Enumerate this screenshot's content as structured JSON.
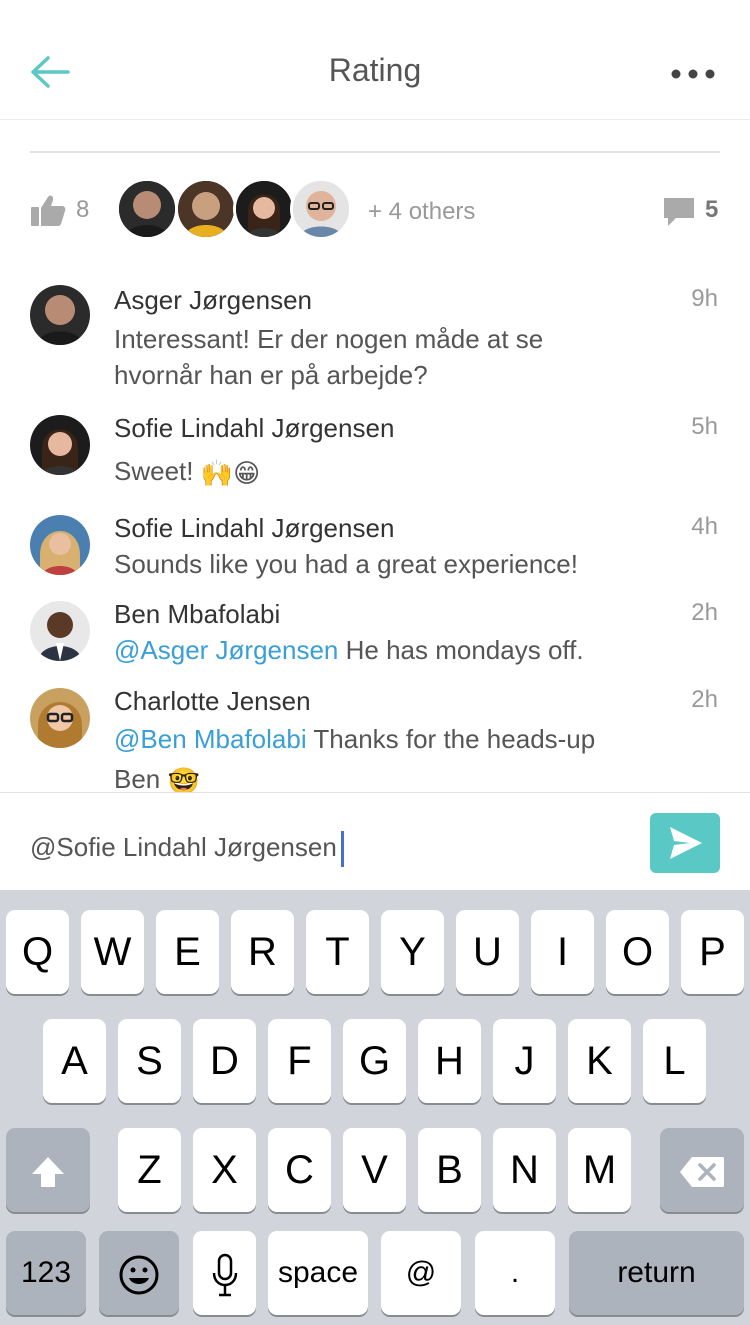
{
  "header": {
    "title": "Rating"
  },
  "likes": {
    "count": "8",
    "others": "+ 4 others",
    "comment_count": "5"
  },
  "comments": [
    {
      "name": "Asger Jørgensen",
      "time": "9h",
      "mention": "",
      "text": "Interessant! Er der nogen måde at se hvornår han er på arbejde?",
      "emoji": ""
    },
    {
      "name": "Sofie Lindahl Jørgensen",
      "time": "5h",
      "mention": "",
      "text": "Sweet!",
      "emoji": "🙌😁"
    },
    {
      "name": "Sofie Lindahl Jørgensen",
      "time": "4h",
      "mention": "",
      "text": "Sounds like you had a great experience!",
      "emoji": ""
    },
    {
      "name": "Ben Mbafolabi",
      "time": "2h",
      "mention": "@Asger Jørgensen",
      "text": "He has mondays off.",
      "emoji": ""
    },
    {
      "name": "Charlotte Jensen",
      "time": "2h",
      "mention": "@Ben Mbafolabi",
      "text": "Thanks for the heads-up Ben",
      "emoji": "🤓"
    }
  ],
  "input": {
    "value": "@Sofie Lindahl Jørgensen"
  },
  "keyboard": {
    "row1": [
      "Q",
      "W",
      "E",
      "R",
      "T",
      "Y",
      "U",
      "I",
      "O",
      "P"
    ],
    "row2": [
      "A",
      "S",
      "D",
      "F",
      "G",
      "H",
      "J",
      "K",
      "L"
    ],
    "row3": [
      "Z",
      "X",
      "C",
      "V",
      "B",
      "N",
      "M"
    ],
    "numbers": "123",
    "space": "space",
    "at": "@",
    "dot": ".",
    "return": "return"
  },
  "colors": {
    "accent": "#5ac8c4",
    "mention": "#3a9fd5"
  }
}
